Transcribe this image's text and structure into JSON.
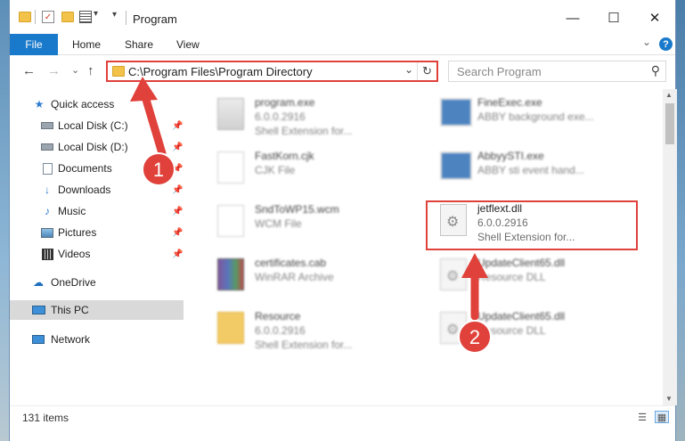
{
  "window": {
    "title": "Program",
    "controls": {
      "minimize": "—",
      "maximize": "☐",
      "close": "✕"
    }
  },
  "ribbon": {
    "file": "File",
    "tabs": [
      "Home",
      "Share",
      "View"
    ],
    "expand": "⌄",
    "help": "?"
  },
  "nav": {
    "back": "←",
    "forward": "→",
    "recent": "⌄",
    "up": "↑",
    "address": "C:\\Program Files\\Program Directory",
    "search_placeholder": "Search Program"
  },
  "sidebar": {
    "items": [
      {
        "label": "Quick access",
        "icon": "star-icon",
        "pinned": false
      },
      {
        "label": "Local Disk (C:)",
        "icon": "drive-icon",
        "pinned": true
      },
      {
        "label": "Local Disk (D:)",
        "icon": "drive-icon",
        "pinned": true
      },
      {
        "label": "Documents",
        "icon": "documents-icon",
        "pinned": true
      },
      {
        "label": "Downloads",
        "icon": "download-icon",
        "pinned": true
      },
      {
        "label": "Music",
        "icon": "music-icon",
        "pinned": true
      },
      {
        "label": "Pictures",
        "icon": "pictures-icon",
        "pinned": true
      },
      {
        "label": "Videos",
        "icon": "videos-icon",
        "pinned": true
      },
      {
        "label": "OneDrive",
        "icon": "cloud-icon",
        "pinned": false
      },
      {
        "label": "This PC",
        "icon": "pc-icon",
        "pinned": false,
        "selected": true
      },
      {
        "label": "Network",
        "icon": "network-icon",
        "pinned": false
      }
    ]
  },
  "files": [
    {
      "name": "program.exe",
      "type": "6.0.0.2916",
      "detail": "Shell Extension for...",
      "icon": "exe-icon"
    },
    {
      "name": "FineExec.exe",
      "type": "ABBY background exe...",
      "detail": "",
      "icon": "app-icon"
    },
    {
      "name": "FastKorn.cjk",
      "type": "CJK File",
      "detail": "",
      "icon": "document-icon"
    },
    {
      "name": "AbbyySTI.exe",
      "type": "ABBY sti event hand...",
      "detail": "",
      "icon": "app-icon"
    },
    {
      "name": "SndToWP15.wcm",
      "type": "WCM File",
      "detail": "",
      "icon": "document-icon"
    },
    {
      "name": "jetflext.dll",
      "type": "6.0.0.2916",
      "detail": "Shell Extension for...",
      "icon": "dll-gear-icon"
    },
    {
      "name": "certificates.cab",
      "type": "WinRAR Archive",
      "detail": "",
      "icon": "archive-icon"
    },
    {
      "name": "UpdateClient65.dll",
      "type": "Resource DLL",
      "detail": "",
      "icon": "dll-gear-icon"
    },
    {
      "name": "Resource",
      "type": "6.0.0.2916",
      "detail": "Shell Extension for...",
      "icon": "folder-icon"
    },
    {
      "name": "UpdateClient65.dll",
      "type": "Resource DLL",
      "detail": "",
      "icon": "dll-gear-icon"
    }
  ],
  "status": {
    "item_count": "131 items"
  },
  "annotations": {
    "step1": "1",
    "step2": "2",
    "color": "#e0413b"
  }
}
